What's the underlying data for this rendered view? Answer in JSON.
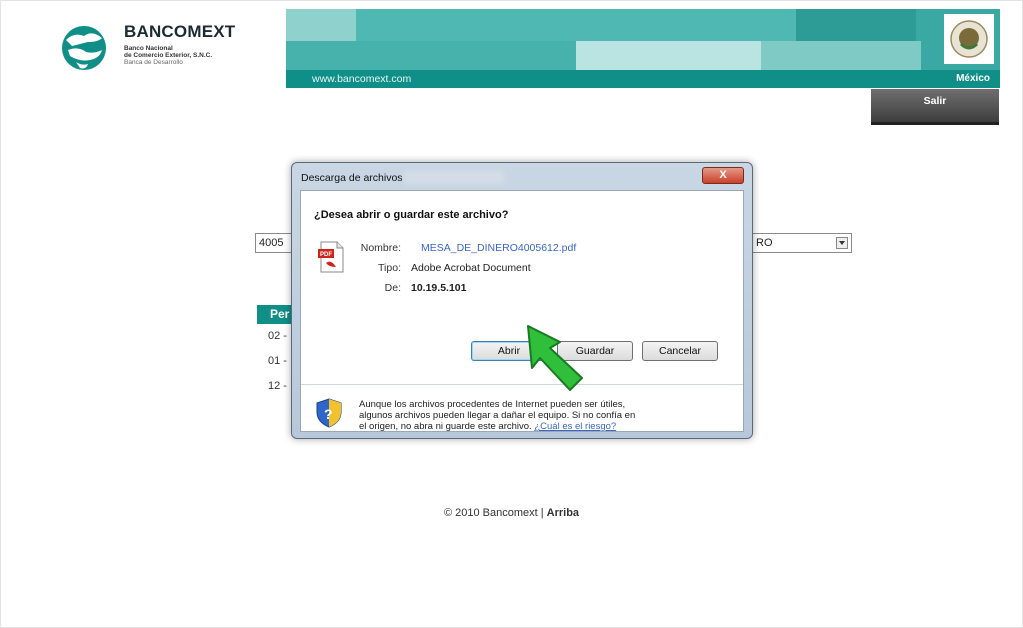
{
  "header": {
    "brand": "BANCOMEXT",
    "brand_sub1": "Banco Nacional",
    "brand_sub2": "de Comercio Exterior, S.N.C.",
    "brand_sub3": "Banca de Desarrollo",
    "url": "www.bancomext.com",
    "country": "México",
    "logout_label": "Salir"
  },
  "background_form": {
    "account_prefix": "4005",
    "select_value": "RO",
    "period_header": "Per",
    "rows": [
      "02 -",
      "01 -",
      "12 -"
    ]
  },
  "dialog": {
    "title": "Descarga de archivos",
    "close_label": "X",
    "question": "¿Desea abrir o guardar este archivo?",
    "fields": {
      "name_label": "Nombre:",
      "name_value": "MESA_DE_DINERO4005612.pdf",
      "type_label": "Tipo:",
      "type_value": "Adobe Acrobat Document",
      "from_label": "De:",
      "from_value": "10.19.5.101"
    },
    "buttons": {
      "open": "Abrir",
      "save": "Guardar",
      "cancel": "Cancelar"
    },
    "warning_line1": "Aunque los archivos procedentes de Internet pueden ser útiles,",
    "warning_line2": "algunos archivos pueden llegar a dañar el equipo. Si no confía en",
    "warning_line3": "el origen, no abra ni guarde este archivo.",
    "warning_link": "¿Cuál es el riesgo?"
  },
  "footer": {
    "copyright": "© 2010 Bancomext | ",
    "top_link": "Arriba"
  },
  "colors": {
    "teal_light": "#3aa9a3",
    "teal_dark": "#0f8f87",
    "link_blue": "#3a66c8",
    "cursor_green": "#2fbf3a"
  }
}
